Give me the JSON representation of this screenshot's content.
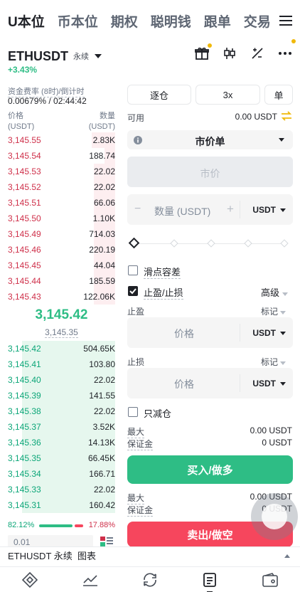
{
  "top_tabs": [
    "U本位",
    "币本位",
    "期权",
    "聪明钱",
    "跟单",
    "交易"
  ],
  "symbol": {
    "name": "ETHUSDT",
    "type": "永续",
    "change": "+3.43%"
  },
  "funding": {
    "label": "资金费率 (8时)/倒计时",
    "value": "0.00679% / 02:44:42"
  },
  "orderbook": {
    "price_header": "价格",
    "price_unit": "(USDT)",
    "qty_header": "数量",
    "qty_unit": "(USDT)",
    "asks": [
      {
        "price": "3,145.55",
        "qty": "2.83K",
        "depth": 0.22
      },
      {
        "price": "3,145.54",
        "qty": "188.74",
        "depth": 0.1
      },
      {
        "price": "3,145.53",
        "qty": "22.02",
        "depth": 0.2
      },
      {
        "price": "3,145.52",
        "qty": "22.02",
        "depth": 0.2
      },
      {
        "price": "3,145.51",
        "qty": "66.06",
        "depth": 0.2
      },
      {
        "price": "3,145.50",
        "qty": "1.10K",
        "depth": 0.2
      },
      {
        "price": "3,145.49",
        "qty": "714.03",
        "depth": 0.2
      },
      {
        "price": "3,145.46",
        "qty": "220.19",
        "depth": 0.2
      },
      {
        "price": "3,145.45",
        "qty": "44.04",
        "depth": 0.2
      },
      {
        "price": "3,145.44",
        "qty": "185.59",
        "depth": 0.2
      },
      {
        "price": "3,145.43",
        "qty": "122.06K",
        "depth": 0.2
      }
    ],
    "mid_price": "3,145.42",
    "mark_price": "3,145.35",
    "bids": [
      {
        "price": "3,145.42",
        "qty": "504.65K",
        "depth": 0.87
      },
      {
        "price": "3,145.41",
        "qty": "103.80",
        "depth": 0.87
      },
      {
        "price": "3,145.40",
        "qty": "22.02",
        "depth": 0.87
      },
      {
        "price": "3,145.39",
        "qty": "141.55",
        "depth": 0.87
      },
      {
        "price": "3,145.38",
        "qty": "22.02",
        "depth": 0.87
      },
      {
        "price": "3,145.37",
        "qty": "3.52K",
        "depth": 0.87
      },
      {
        "price": "3,145.36",
        "qty": "14.13K",
        "depth": 0.87
      },
      {
        "price": "3,145.35",
        "qty": "66.45K",
        "depth": 0.87
      },
      {
        "price": "3,145.34",
        "qty": "166.71",
        "depth": 0.87
      },
      {
        "price": "3,145.33",
        "qty": "22.02",
        "depth": 0.87
      },
      {
        "price": "3,145.31",
        "qty": "160.42",
        "depth": 0.87
      }
    ],
    "buy_ratio": "82.12%",
    "sell_ratio": "17.88%",
    "precision": "0.01"
  },
  "order": {
    "margin_mode": "逐仓",
    "leverage": "3x",
    "position_mode": "单",
    "available_label": "可用",
    "available_value": "0.00 USDT",
    "order_type": "市价单",
    "market_price_placeholder": "市价",
    "qty_placeholder": "数量 (USDT)",
    "unit": "USDT",
    "slippage_label": "滑点容差",
    "tpsl_label": "止盈/止损",
    "advanced_label": "高级",
    "take_profit_label": "止盈",
    "stop_loss_label": "止损",
    "mark_label": "标记",
    "price_placeholder": "价格",
    "reduce_only_label": "只减仓",
    "max_label": "最大",
    "margin_label": "保证金",
    "buy_max": "0.00 USDT",
    "buy_margin": "0 USDT",
    "buy_button": "买入/做多",
    "sell_max": "0.00 USDT",
    "sell_margin": "0 USDT",
    "sell_button": "卖出/做空"
  },
  "bottom_bar": {
    "label": "ETHUSDT 永续  图表"
  },
  "colors": {
    "up": "#2ebd85",
    "down": "#f6465d",
    "accent": "#f0b90b"
  }
}
